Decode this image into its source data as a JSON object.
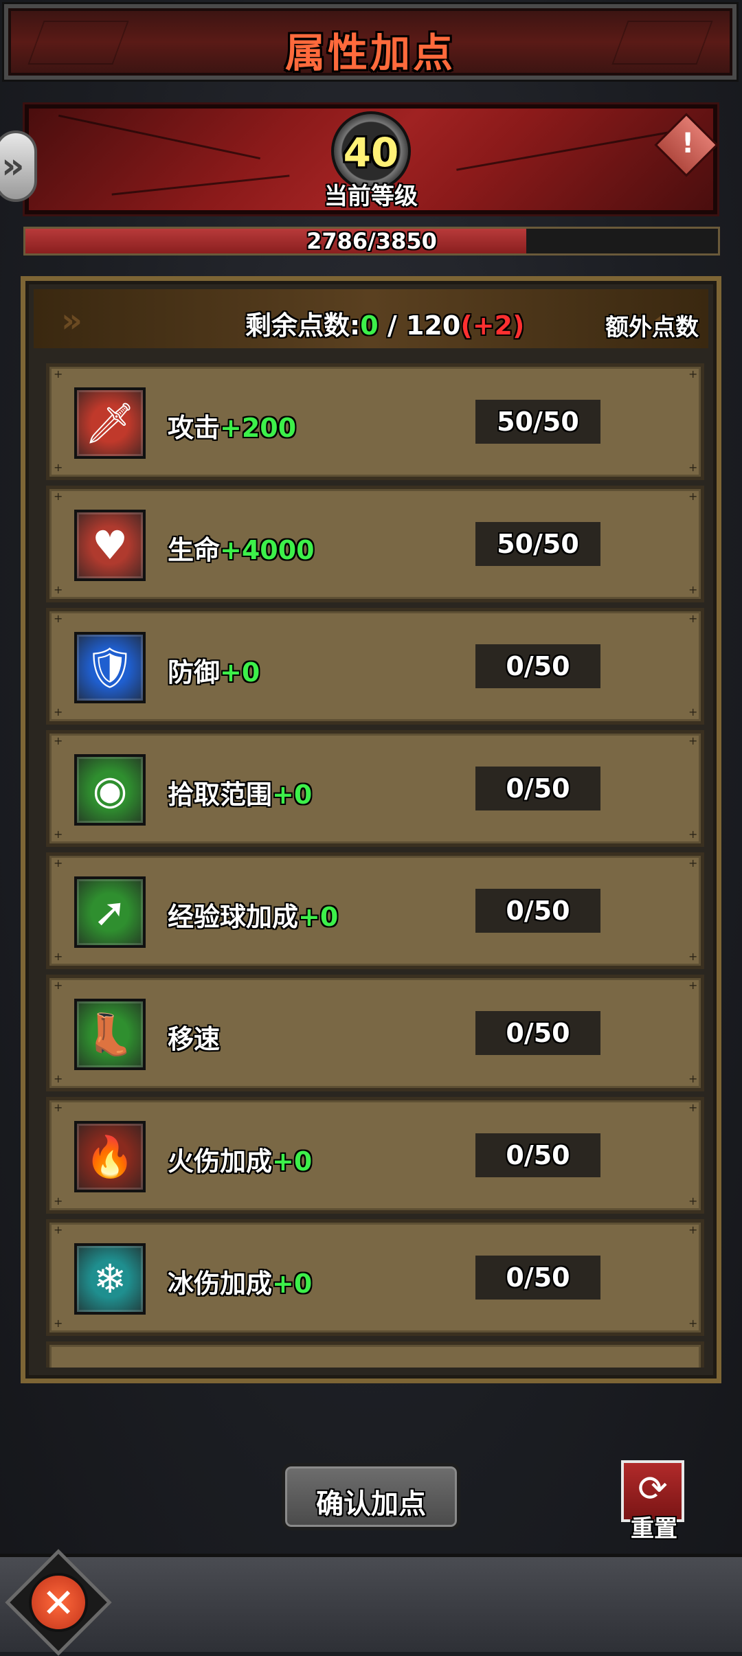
{
  "header": {
    "title": "属性加点"
  },
  "level": {
    "value": "40",
    "label": "当前等级",
    "warning_icon": "exclamation-icon"
  },
  "exp": {
    "text": "2786/3850",
    "current": 2786,
    "max": 3850
  },
  "points": {
    "label": "剩余点数:",
    "remaining": "0",
    "separator": " / 120",
    "bonus": "(+2)",
    "extra_label": "额外点数"
  },
  "attributes": [
    {
      "name": "攻击",
      "bonus": "+200",
      "count": "50/50",
      "icon": "sword-icon",
      "color": "#c0392b"
    },
    {
      "name": "生命",
      "bonus": "+4000",
      "count": "50/50",
      "icon": "heart-icon",
      "color": "#b03a2e"
    },
    {
      "name": "防御",
      "bonus": "+0",
      "count": "0/50",
      "icon": "shield-icon",
      "color": "#1f5fd0"
    },
    {
      "name": "拾取范围",
      "bonus": "+0",
      "count": "0/50",
      "icon": "magnet-icon",
      "color": "#2f8f2f"
    },
    {
      "name": "经验球加成",
      "bonus": "+0",
      "count": "0/50",
      "icon": "exp-orb-icon",
      "color": "#2f8f2f"
    },
    {
      "name": "移速",
      "bonus": "",
      "count": "0/50",
      "icon": "boot-icon",
      "color": "#2f8f2f"
    },
    {
      "name": "火伤加成",
      "bonus": "+0",
      "count": "0/50",
      "icon": "fire-icon",
      "color": "#8a2a1e"
    },
    {
      "name": "冰伤加成",
      "bonus": "+0",
      "count": "0/50",
      "icon": "snowflake-icon",
      "color": "#1f8f8f"
    }
  ],
  "buttons": {
    "confirm": "确认加点",
    "reset": "重置"
  },
  "colors": {
    "bonus_green": "#3df04a",
    "bonus_red": "#ff3030",
    "title": "#ff6a3c"
  }
}
